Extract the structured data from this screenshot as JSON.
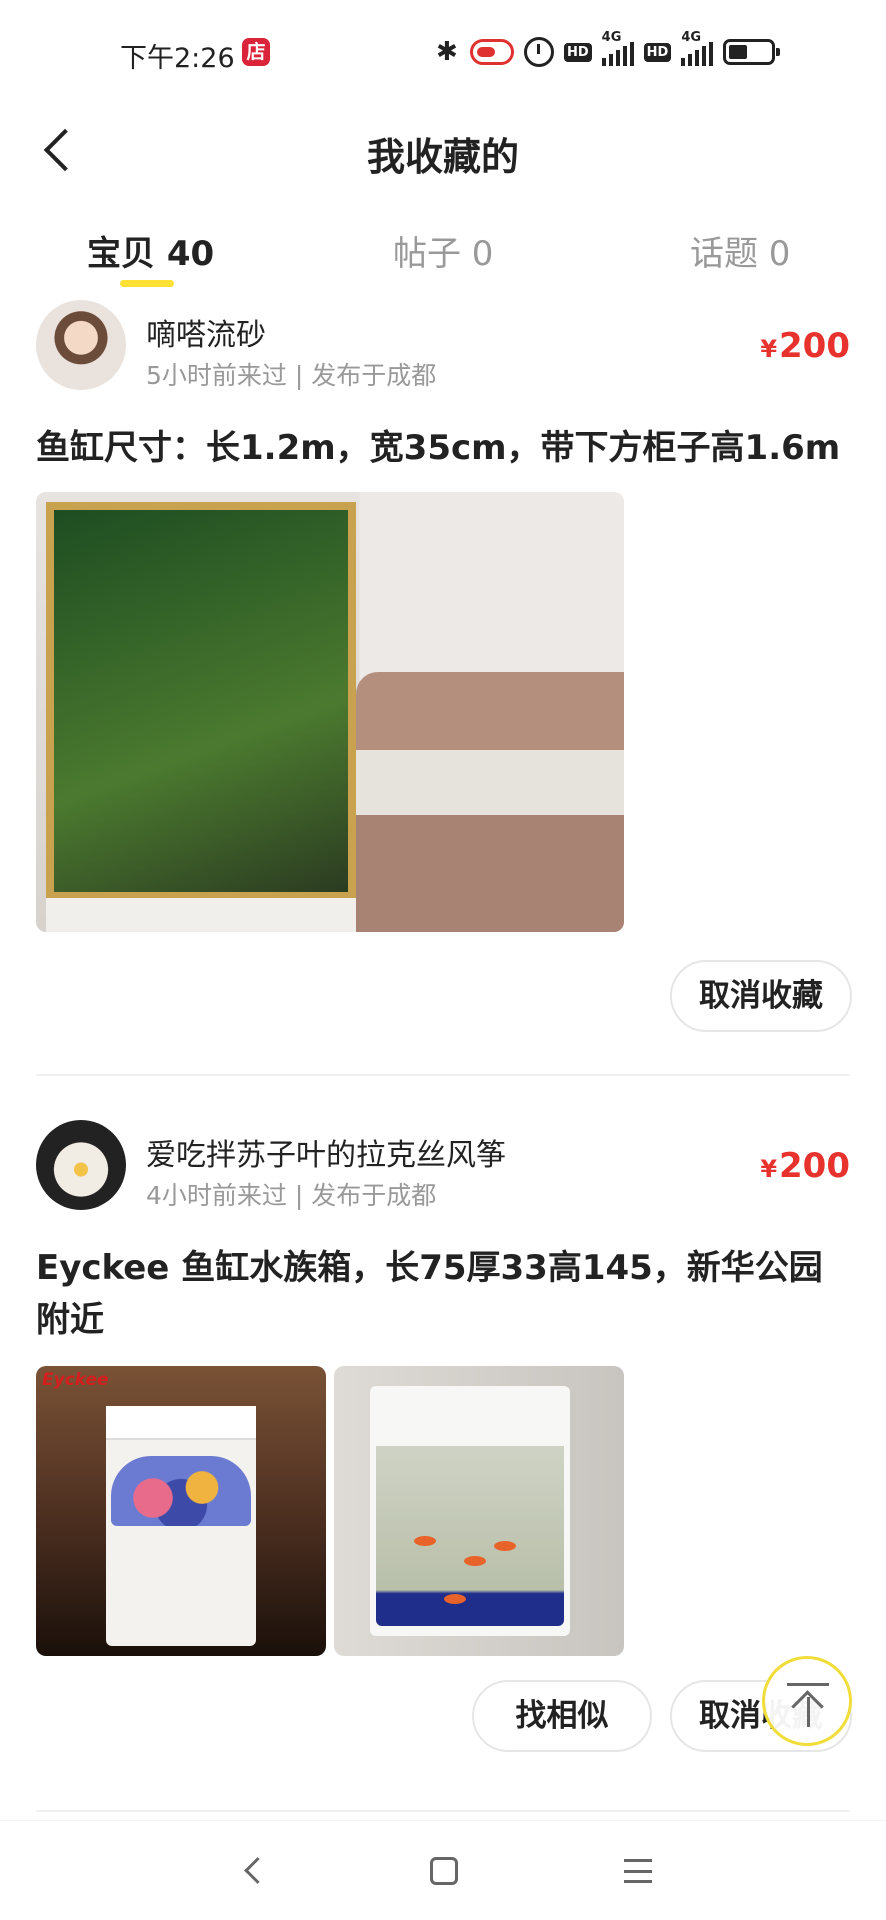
{
  "status_bar": {
    "time": "下午2:26",
    "store_badge": "店",
    "network_label_1": "4G",
    "network_label_2": "4G",
    "hd_label_1": "HD",
    "hd_label_2": "HD"
  },
  "header": {
    "title": "我收藏的"
  },
  "tabs": [
    {
      "label": "宝贝 40",
      "active": true
    },
    {
      "label": "帖子 0",
      "active": false
    },
    {
      "label": "话题 0",
      "active": false
    }
  ],
  "items": [
    {
      "user_name": "嘀嗒流砂",
      "meta": "5小时前来过 | 发布于成都",
      "price_symbol": "¥",
      "price": "200",
      "title": "鱼缸尺寸：长1.2m，宽35cm，带下方柜子高1.6m",
      "buttons": {
        "unfavorite": "取消收藏"
      }
    },
    {
      "user_name": "爱吃拌苏子叶的拉克丝风筝",
      "meta": "4小时前来过 | 发布于成都",
      "price_symbol": "¥",
      "price": "200",
      "title": "Eyckee 鱼缸水族箱，长75厚33高145，新华公园附近",
      "image_brand": "Eyckee",
      "buttons": {
        "similar": "找相似",
        "unfavorite": "取消收藏"
      }
    }
  ],
  "colors": {
    "accent_yellow": "#ffe033",
    "price_red": "#e8322e"
  }
}
